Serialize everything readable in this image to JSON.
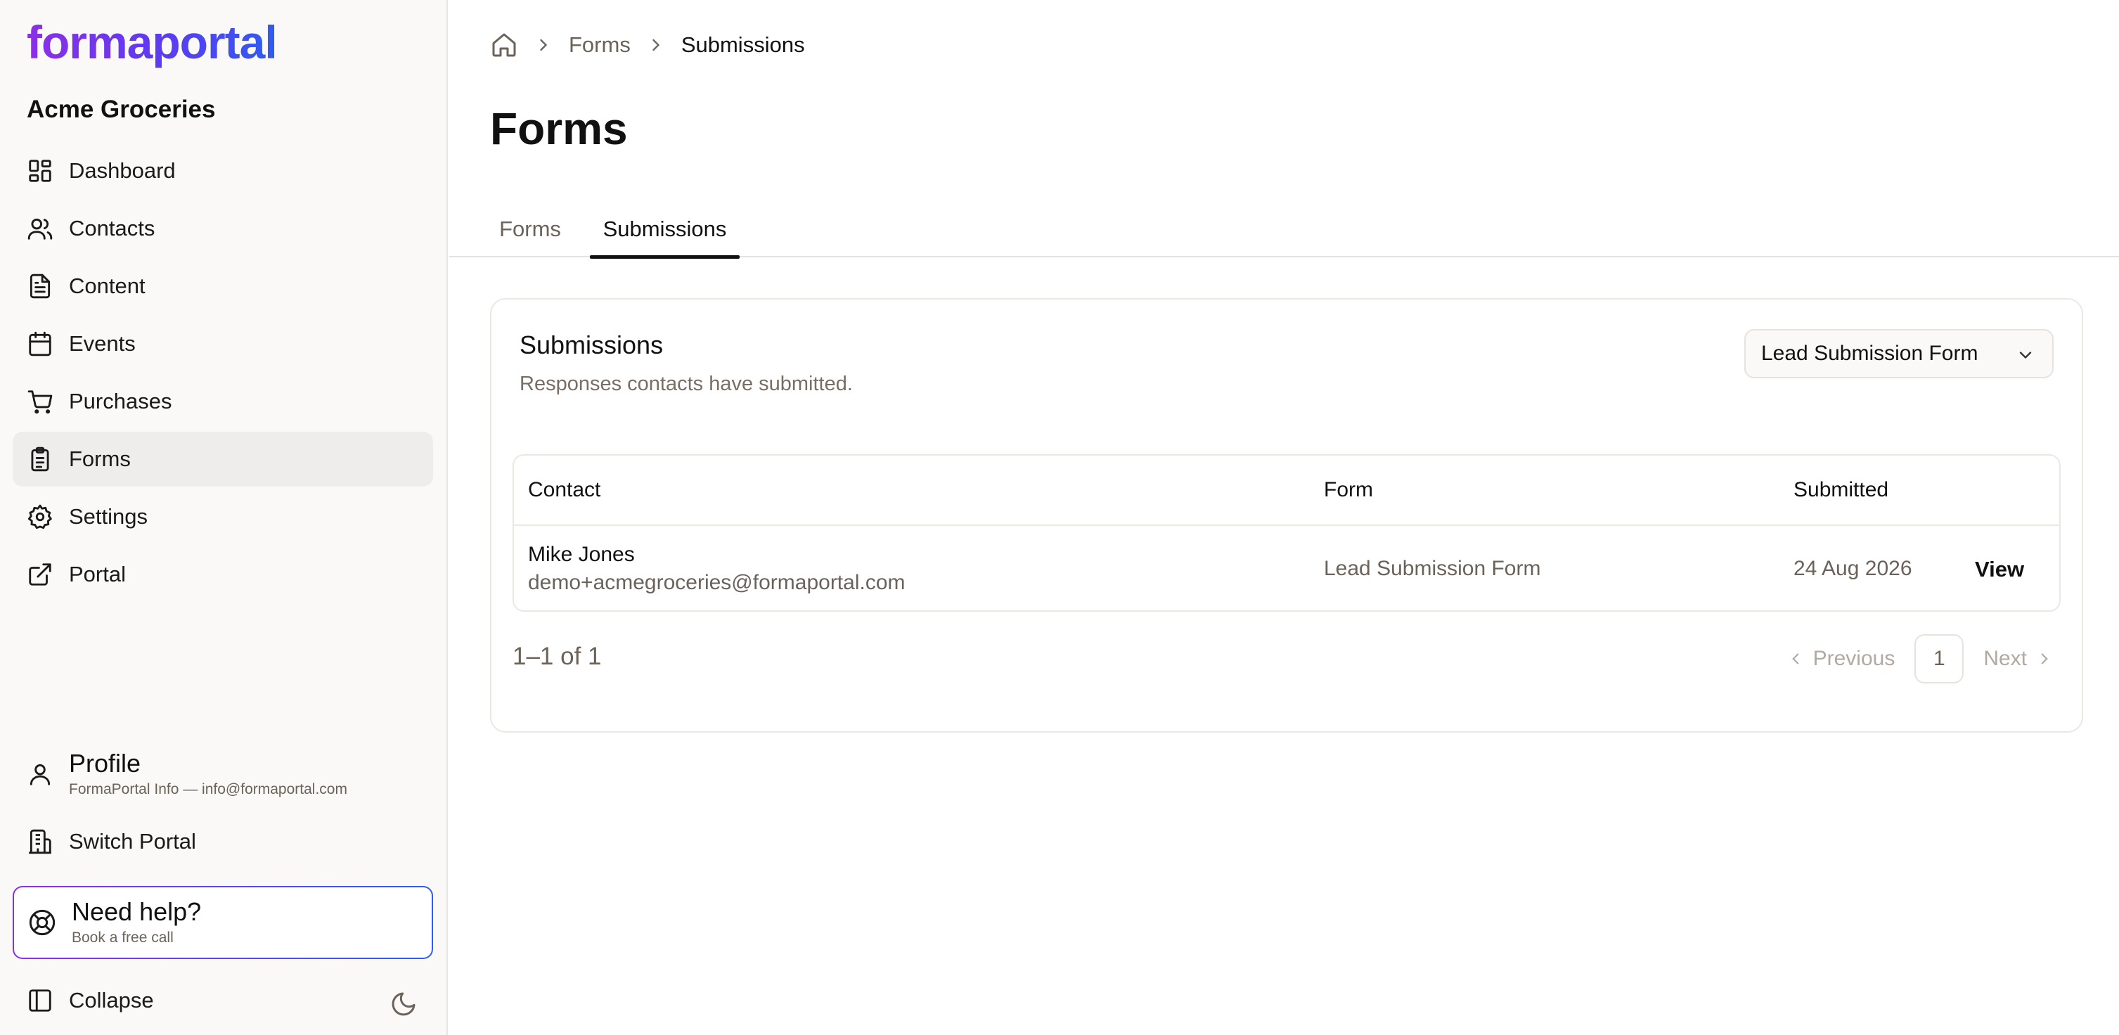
{
  "app": {
    "logo_text": "formaportal",
    "brand_gradient": [
      "#8b2fe6",
      "#2f5cf0"
    ]
  },
  "sidebar": {
    "org_name": "Acme Groceries",
    "items": [
      {
        "label": "Dashboard",
        "icon": "dashboard-icon"
      },
      {
        "label": "Contacts",
        "icon": "users-icon"
      },
      {
        "label": "Content",
        "icon": "document-icon"
      },
      {
        "label": "Events",
        "icon": "calendar-icon"
      },
      {
        "label": "Purchases",
        "icon": "cart-icon"
      },
      {
        "label": "Forms",
        "icon": "clipboard-icon",
        "active": true
      },
      {
        "label": "Settings",
        "icon": "gear-icon"
      },
      {
        "label": "Portal",
        "icon": "external-link-icon"
      }
    ],
    "profile": {
      "title": "Profile",
      "subtitle": "FormaPortal Info — info@formaportal.com"
    },
    "switch_portal": "Switch Portal",
    "help": {
      "title": "Need help?",
      "subtitle": "Book a free call"
    },
    "collapse": "Collapse"
  },
  "breadcrumb": {
    "items": [
      "Forms",
      "Submissions"
    ]
  },
  "page": {
    "title": "Forms",
    "tabs": [
      "Forms",
      "Submissions"
    ],
    "active_tab": "Submissions"
  },
  "submissions": {
    "title": "Submissions",
    "description": "Responses contacts have submitted.",
    "form_select": "Lead Submission Form",
    "columns": [
      "Contact",
      "Form",
      "Submitted"
    ],
    "rows": [
      {
        "name": "Mike Jones",
        "email": "demo+acmegroceries@formaportal.com",
        "form": "Lead Submission Form",
        "submitted": "24 Aug 2026",
        "action": "View"
      }
    ],
    "range": "1–1 of 1",
    "pagination": {
      "previous": "Previous",
      "page": "1",
      "next": "Next"
    }
  }
}
